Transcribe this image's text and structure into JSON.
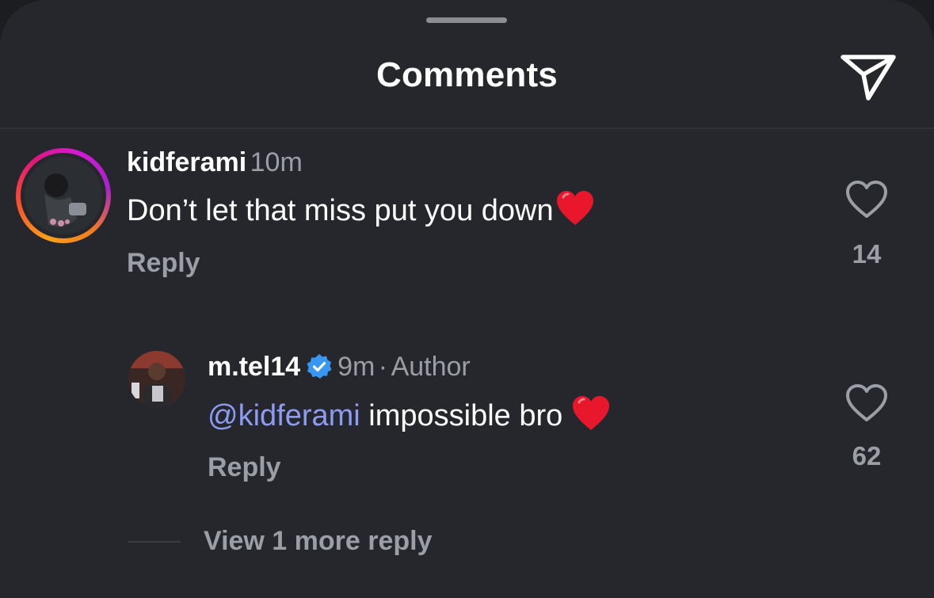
{
  "header": {
    "title": "Comments"
  },
  "comments": [
    {
      "username": "kidferami",
      "time": "10m",
      "text": "Don’t let that miss put you down",
      "emoji": "❤️",
      "reply_label": "Reply",
      "likes": "14"
    }
  ],
  "replies": [
    {
      "username": "m.tel14",
      "time": "9m",
      "separator": "·",
      "author_badge": "Author",
      "mention": "@kidferami",
      "text": " impossible bro ",
      "emoji": "❤️",
      "reply_label": "Reply",
      "likes": "62"
    }
  ],
  "view_more": "View 1 more reply",
  "icons": {
    "send": "send-icon",
    "like": "heart-outline-icon",
    "verified": "verified-badge-icon"
  },
  "colors": {
    "background": "#25272c",
    "mention": "#8d9cf3",
    "verified": "#3897f0",
    "muted": "#9b9ea4"
  }
}
